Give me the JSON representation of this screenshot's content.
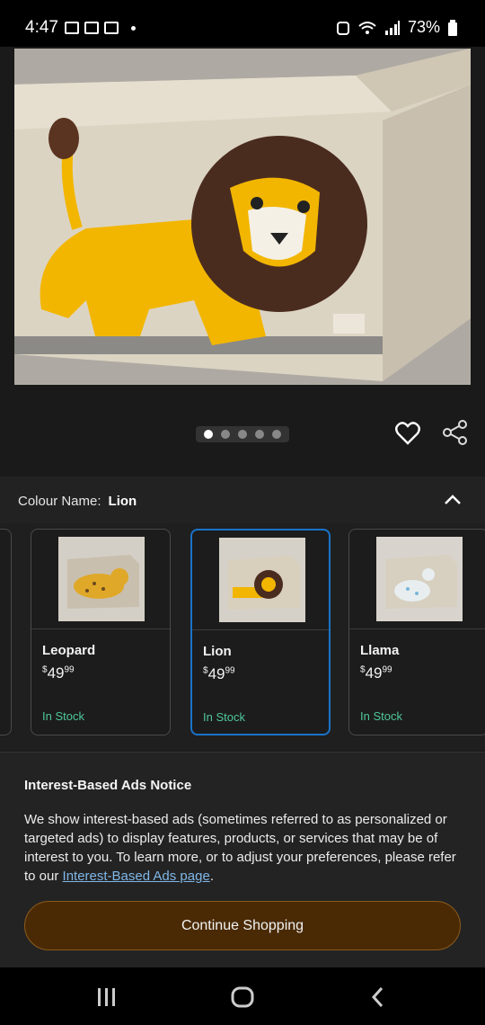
{
  "status_bar": {
    "time": "4:47",
    "battery": "73%"
  },
  "carousel": {
    "count": 5,
    "active_index": 0
  },
  "colour_section": {
    "label": "Colour Name:",
    "value": "Lion"
  },
  "swatches": [
    {
      "name": "Leopard",
      "price_symbol": "$",
      "price_whole": "49",
      "price_fraction": "99",
      "stock": "In Stock"
    },
    {
      "name": "Lion",
      "price_symbol": "$",
      "price_whole": "49",
      "price_fraction": "99",
      "stock": "In Stock"
    },
    {
      "name": "Llama",
      "price_symbol": "$",
      "price_whole": "49",
      "price_fraction": "99",
      "stock": "In Stock"
    }
  ],
  "notice": {
    "title": "Interest-Based Ads Notice",
    "body": "We show interest-based ads (sometimes referred to as personalized or targeted ads) to display features, products, or services that may be of interest to you. To learn more, or to adjust your preferences, please refer to our ",
    "link": "Interest-Based Ads page",
    "body_end": ".",
    "button": "Continue Shopping"
  },
  "colors": {
    "accent_selected": "#1a73c8",
    "in_stock": "#4ec79a",
    "button_bg": "#4a2a05"
  }
}
